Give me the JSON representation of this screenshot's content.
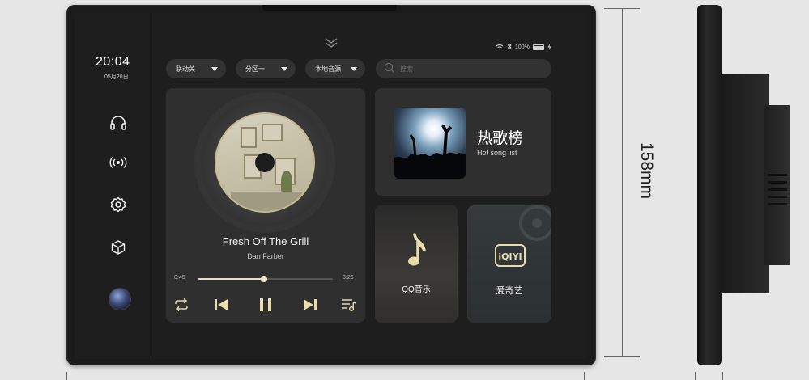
{
  "status_bar": {
    "battery_text": "100%"
  },
  "sidebar": {
    "time": "20:04",
    "date": "05月20日",
    "items": [
      {
        "icon": "headphones-icon"
      },
      {
        "icon": "broadcast-icon"
      },
      {
        "icon": "gear-icon"
      },
      {
        "icon": "cube-icon"
      }
    ]
  },
  "filters": [
    {
      "label": "联动关"
    },
    {
      "label": "分区一"
    },
    {
      "label": "本地音源"
    }
  ],
  "search": {
    "placeholder": "搜索"
  },
  "player": {
    "title": "Fresh Off The Grill",
    "artist": "Dan Farber",
    "current_time": "0:45",
    "total_time": "3:26",
    "progress": 0.49
  },
  "cards": {
    "hot_songs": {
      "title": "热歌榜",
      "subtitle": "Hot song list"
    },
    "qq_music": {
      "label": "QQ音乐"
    },
    "iqiyi": {
      "label": "爱奇艺",
      "logo_text": "iQIYI"
    }
  },
  "dimension": {
    "label": "158mm"
  },
  "colors": {
    "accent": "#e7dcaa",
    "card_bg": "#2f2f2f",
    "screen_bg": "#1e1e1e"
  }
}
